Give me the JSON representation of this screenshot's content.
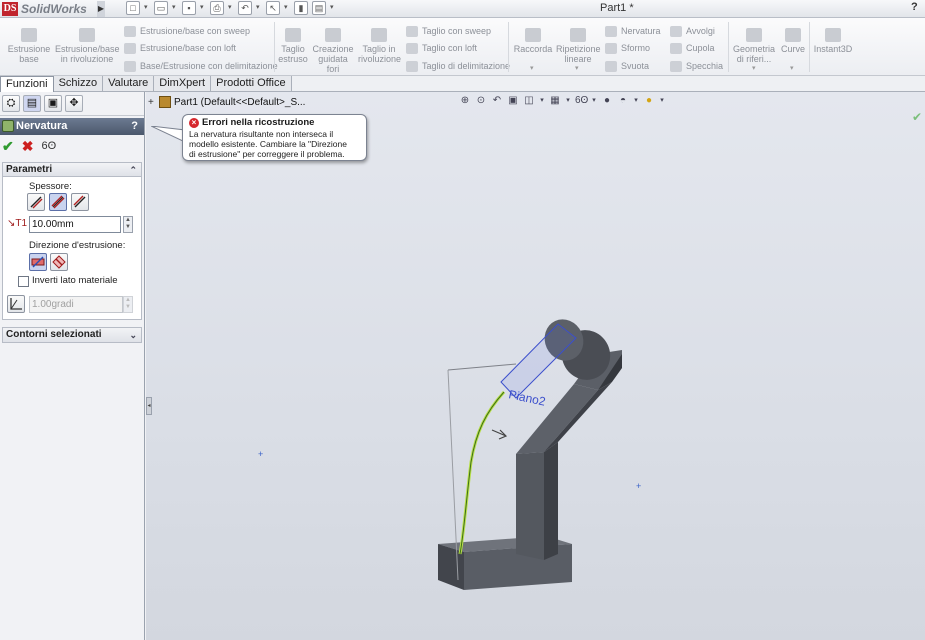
{
  "app": {
    "logo_text": "SolidWorks",
    "document_title": "Part1 *",
    "help": "?"
  },
  "ribbon": {
    "estrusione_base": "Estrusione base",
    "estrusione_rivoluzione": "Estrusione/base in rivoluzione",
    "estrusione_sweep": "Estrusione/base con sweep",
    "base_loft": "Estrusione/base con loft",
    "base_delimitazione": "Base/Estrusione con delimitazione",
    "taglio_estruso": "Taglio estruso",
    "creazione_guidata_fori": "Creazione guidata fori",
    "taglio_rivoluzione": "Taglio in rivoluzione",
    "taglio_sweep": "Taglio con sweep",
    "taglio_loft": "Taglio con loft",
    "taglio_delimitazione": "Taglio di delimitazione",
    "raccorda": "Raccorda",
    "ripetizione_lineare": "Ripetizione lineare",
    "nervatura": "Nervatura",
    "sformo": "Sformo",
    "svuota": "Svuota",
    "avvolgi": "Avvolgi",
    "cupola": "Cupola",
    "specchia": "Specchia",
    "geometria_riferimento": "Geometria di riferi...",
    "curve": "Curve",
    "instant3d": "Instant3D"
  },
  "tabs": [
    "Funzioni",
    "Schizzo",
    "Valutare",
    "DimXpert",
    "Prodotti Office"
  ],
  "property_manager": {
    "title": "Nervatura",
    "help": "?",
    "parametri": {
      "header": "Parametri",
      "spessore_label": "Spessore:",
      "thickness_value": "10.00mm",
      "direzione_label": "Direzione d'estrusione:",
      "inverti_label": "Inverti lato materiale",
      "draft_value": "1.00gradi"
    },
    "contorni": {
      "header": "Contorni selezionati"
    }
  },
  "feature_tree": {
    "node_text": "Part1  (Default<<Default>_S..."
  },
  "tooltip": {
    "title": "Errori nella ricostruzione",
    "body_line1": "La nervatura risultante non interseca il",
    "body_line2": "modello esistente. Cambiare la \"Direzione",
    "body_line3": "di estrusione\" per correggere il problema."
  },
  "model": {
    "plane_label": "Piano2"
  },
  "colors": {
    "header_bg": "#55627a",
    "error": "#d6282e",
    "rib_curve": "#b8e04a",
    "plane": "#3b4fcc",
    "body_dark": "#3e4148",
    "body_mid": "#5a5e66",
    "body_light": "#7a7e87"
  }
}
